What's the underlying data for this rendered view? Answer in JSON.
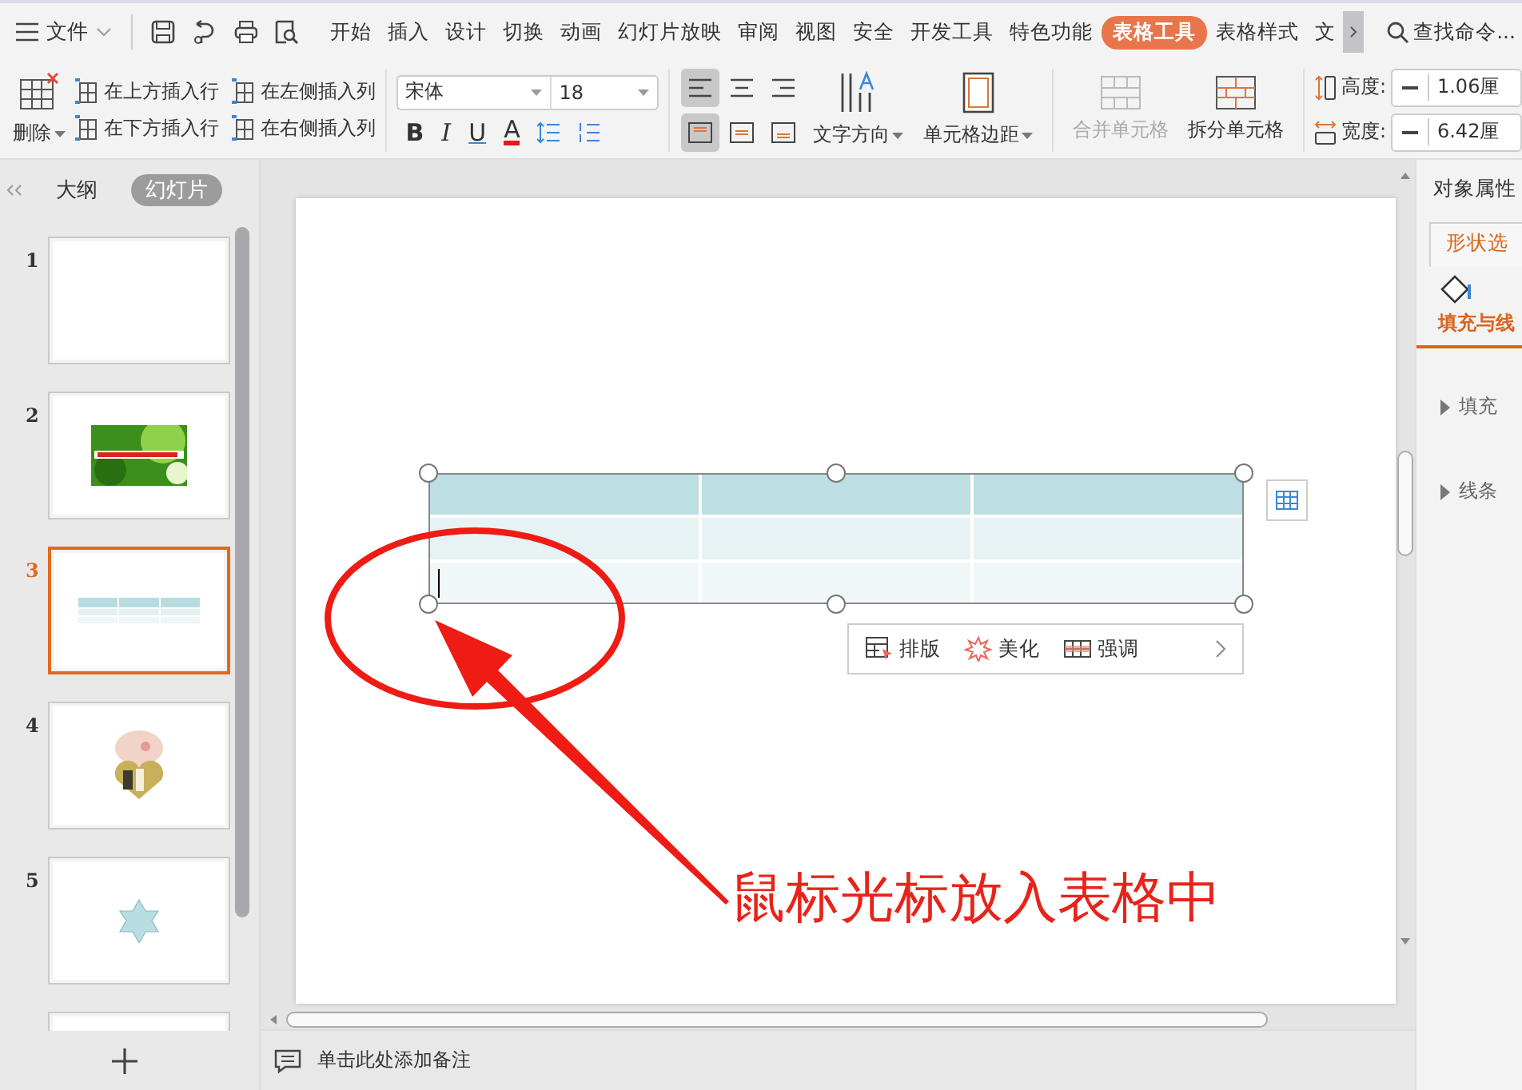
{
  "menu_bar": {
    "file": "文件",
    "tabs": [
      {
        "label": "开始",
        "selected": false
      },
      {
        "label": "插入",
        "selected": false
      },
      {
        "label": "设计",
        "selected": false
      },
      {
        "label": "切换",
        "selected": false
      },
      {
        "label": "动画",
        "selected": false
      },
      {
        "label": "幻灯片放映",
        "selected": false
      },
      {
        "label": "审阅",
        "selected": false
      },
      {
        "label": "视图",
        "selected": false
      },
      {
        "label": "安全",
        "selected": false
      },
      {
        "label": "开发工具",
        "selected": false
      },
      {
        "label": "特色功能",
        "selected": false
      },
      {
        "label": "表格工具",
        "selected": true
      },
      {
        "label": "表格样式",
        "selected": false
      },
      {
        "label": "文",
        "selected": false
      }
    ],
    "search": "查找命令..."
  },
  "ribbon": {
    "delete": "删除",
    "insert": [
      "在上方插入行",
      "在左侧插入列",
      "在下方插入行",
      "在右侧插入列"
    ],
    "font": "宋体",
    "font_size": "18",
    "format": [
      {
        "kind": "bold",
        "label": "B"
      },
      {
        "kind": "italic",
        "label": "I"
      },
      {
        "kind": "underline",
        "label": "U"
      },
      {
        "kind": "color",
        "label": "A"
      }
    ],
    "align": [
      {
        "kind": "left",
        "selected": true
      },
      {
        "kind": "center",
        "selected": false
      },
      {
        "kind": "right",
        "selected": false
      },
      {
        "kind": "top",
        "selected": true
      },
      {
        "kind": "middle",
        "selected": false
      },
      {
        "kind": "bottom",
        "selected": false
      }
    ],
    "text_direction": "文字方向",
    "cell_margin": "单元格边距",
    "merge": {
      "label": "合并单元格",
      "disabled": true
    },
    "split": {
      "label": "拆分单元格",
      "disabled": false
    },
    "height": {
      "label": "高度:",
      "value": "1.06厘"
    },
    "width": {
      "label": "宽度:",
      "value": "6.42厘"
    }
  },
  "slide_panel": {
    "tabs": [
      {
        "label": "大纲",
        "selected": false
      },
      {
        "label": "幻灯片",
        "selected": true
      }
    ],
    "slides": [
      {
        "number": "1",
        "kind": "blank",
        "selected": false
      },
      {
        "number": "2",
        "selected": false
      },
      {
        "number": "3",
        "kind": "table",
        "selected": true
      },
      {
        "number": "4",
        "kind": "shapes",
        "selected": false
      },
      {
        "number": "5",
        "kind": "star",
        "selected": false
      },
      {
        "kind": "blank",
        "selected": false
      }
    ]
  },
  "slide": {
    "table": {
      "rows": [
        {
          "kind": "header",
          "cursor": false
        },
        {
          "kind": "band",
          "cursor": false
        },
        {
          "kind": "light",
          "cursor": true
        }
      ]
    },
    "quick_toolbar": [
      {
        "kind": "layout",
        "label": "排版"
      },
      {
        "kind": "beautify",
        "label": "美化"
      },
      {
        "kind": "emphasis",
        "label": "强调"
      }
    ],
    "annotation": "鼠标光标放入表格中"
  },
  "properties_panel": {
    "title": "对象属性",
    "tab": "形状选",
    "section": "填充与线",
    "groups": [
      "填充",
      "线条"
    ]
  },
  "notes": "单击此处添加备注"
}
